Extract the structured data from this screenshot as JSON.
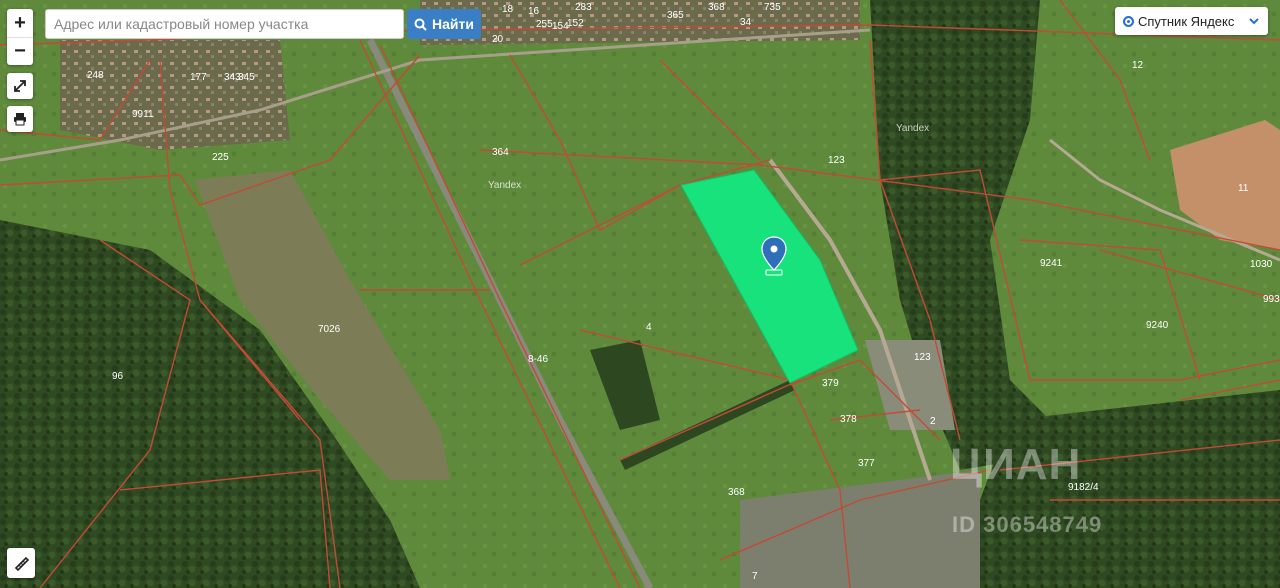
{
  "search": {
    "placeholder": "Адрес или кадастровый номер участка",
    "button_label": "Найти"
  },
  "zoom": {
    "in_label": "+",
    "out_label": "−"
  },
  "layer": {
    "selected": "Спутник Яндекс"
  },
  "watermark": {
    "logo": "ЦИАН",
    "id": "ID 306548749"
  },
  "map": {
    "yandex_marks": [
      "Yandex",
      "Yandex"
    ],
    "parcel_labels": [
      "20",
      "283",
      "18",
      "16",
      "255",
      "154",
      "152",
      "365",
      "368",
      "735",
      "34",
      "9911",
      "248",
      "343",
      "345",
      "177",
      "225",
      "364",
      "123",
      "378",
      "123",
      "379",
      "377",
      "4",
      "7026",
      "96",
      "368",
      "12",
      "11",
      "9241",
      "1030",
      "993",
      "9240",
      "2",
      "9182/4",
      "7",
      "8-46"
    ],
    "highlighted_parcel_color": "#18e27c",
    "boundary_color": "#c24a36"
  },
  "icons": {
    "expand": "expand-icon",
    "print": "print-icon",
    "ruler": "ruler-icon",
    "pin": "map-pin-icon",
    "search": "search-icon",
    "chevron": "chevron-down-icon"
  }
}
